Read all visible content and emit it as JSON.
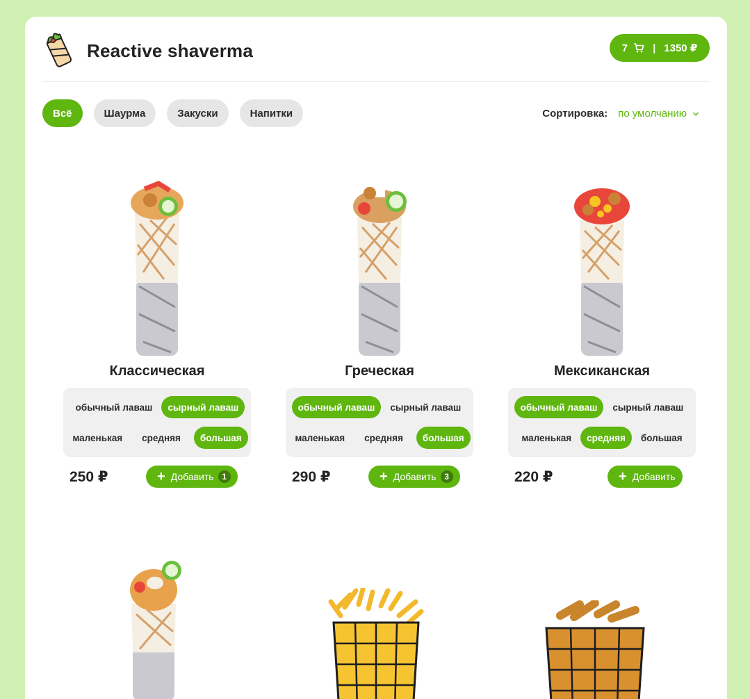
{
  "header": {
    "title": "Reactive shaverma",
    "cart": {
      "count": "7",
      "separator": "|",
      "total": "1350 ₽"
    }
  },
  "categories": [
    "Всё",
    "Шаурма",
    "Закуски",
    "Напитки"
  ],
  "sort": {
    "label": "Сортировка:",
    "value": "по умолчанию"
  },
  "products": [
    {
      "name": "Классическая",
      "dough": [
        "обычный лаваш",
        "сырный лаваш"
      ],
      "sizes": [
        "маленькая",
        "средняя",
        "большая"
      ],
      "price": "250 ₽",
      "add_label": "Добавить",
      "add_count": "1"
    },
    {
      "name": "Греческая",
      "dough": [
        "обычный лаваш",
        "сырный лаваш"
      ],
      "sizes": [
        "маленькая",
        "средняя",
        "большая"
      ],
      "price": "290 ₽",
      "add_label": "Добавить",
      "add_count": "3"
    },
    {
      "name": "Мексиканская",
      "dough": [
        "обычный лаваш",
        "сырный лаваш"
      ],
      "sizes": [
        "маленькая",
        "средняя",
        "большая"
      ],
      "price": "220 ₽",
      "add_label": "Добавить",
      "add_count": ""
    }
  ],
  "colors": {
    "accent": "#5eb60e",
    "background": "#d1f0b4"
  }
}
